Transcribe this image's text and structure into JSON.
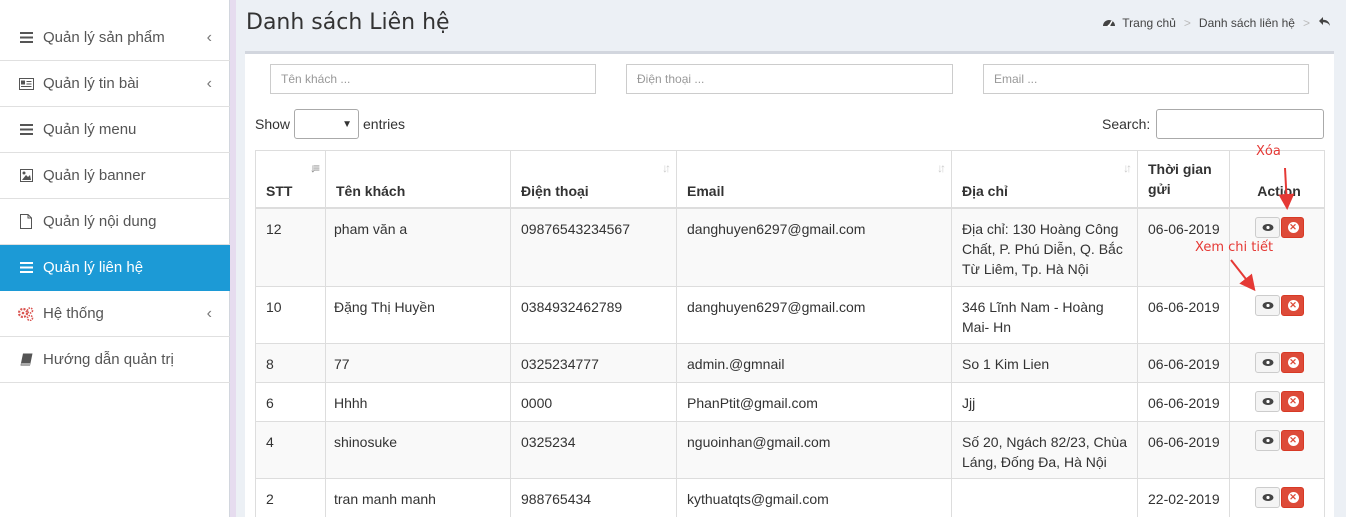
{
  "sidebar": {
    "items": [
      {
        "label": "Quản lý sản phẩm",
        "icon": "list-icon",
        "has_submenu": true
      },
      {
        "label": "Quản lý tin bài",
        "icon": "newspaper-icon",
        "has_submenu": true
      },
      {
        "label": "Quản lý menu",
        "icon": "list-icon",
        "has_submenu": false
      },
      {
        "label": "Quản lý banner",
        "icon": "image-icon",
        "has_submenu": false
      },
      {
        "label": "Quản lý nội dung",
        "icon": "file-icon",
        "has_submenu": false
      },
      {
        "label": "Quản lý liên hệ",
        "icon": "list-icon",
        "has_submenu": false,
        "active": true
      },
      {
        "label": "Hệ thống",
        "icon": "cogs-icon",
        "has_submenu": true
      },
      {
        "label": "Hướng dẫn quản trị",
        "icon": "book-icon",
        "has_submenu": false
      }
    ]
  },
  "header": {
    "title": "Danh sách Liên hệ",
    "breadcrumb": {
      "home": "Trang chủ",
      "current": "Danh sách liên hệ"
    }
  },
  "filters": {
    "name_placeholder": "Tên khách ...",
    "phone_placeholder": "Điện thoại ...",
    "email_placeholder": "Email ..."
  },
  "controls": {
    "show_label": "Show",
    "entries_label": "entries",
    "search_label": "Search:"
  },
  "table": {
    "columns": [
      "STT",
      "Tên khách",
      "Điện thoại",
      "Email",
      "Địa chỉ",
      "Thời gian gửi",
      "Action"
    ],
    "rows": [
      {
        "stt": "12",
        "name": "pham văn a",
        "phone": "09876543234567",
        "email": "danghuyen6297@gmail.com",
        "address": "Địa chỉ: 130 Hoàng Công Chất, P. Phú Diễn, Q. Bắc Từ Liêm, Tp. Hà Nội",
        "date": "06-06-2019"
      },
      {
        "stt": "10",
        "name": "Đặng Thị Huyền",
        "phone": "0384932462789",
        "email": "danghuyen6297@gmail.com",
        "address": "346 Lĩnh Nam - Hoàng Mai- Hn",
        "date": "06-06-2019"
      },
      {
        "stt": "8",
        "name": "77",
        "phone": "0325234777",
        "email": "admin.@gmnail",
        "address": "So 1 Kim Lien",
        "date": "06-06-2019"
      },
      {
        "stt": "6",
        "name": "Hhhh",
        "phone": "0000",
        "email": "PhanPtit@gmail.com",
        "address": "Jjj",
        "date": "06-06-2019"
      },
      {
        "stt": "4",
        "name": "shinosuke",
        "phone": "0325234",
        "email": "nguoinhan@gmail.com",
        "address": "Số 20, Ngách 82/23, Chùa Láng, Đống Đa, Hà Nội",
        "date": "06-06-2019"
      },
      {
        "stt": "2",
        "name": "tran manh manh",
        "phone": "988765434",
        "email": "kythuatqts@gmail.com",
        "address": "",
        "date": "22-02-2019"
      }
    ]
  },
  "annotations": {
    "delete": "Xóa",
    "view": "Xem chi tiết"
  },
  "colors": {
    "active": "#1c9ad6",
    "danger": "#dd4b39",
    "annotation": "#e53935"
  }
}
